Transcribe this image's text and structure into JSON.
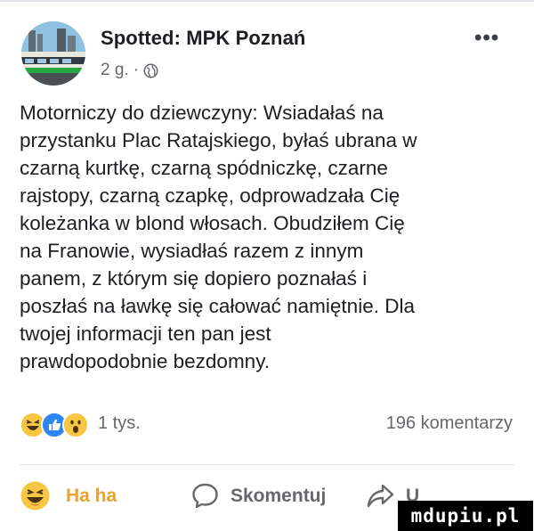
{
  "post": {
    "page_name": "Spotted: MPK Poznań",
    "time": "2 g.",
    "separator": "·",
    "privacy_icon": "globe-icon",
    "more_label": "•••",
    "text": "Motorniczy do dziewczyny: Wsiadałaś na\nprzystanku Plac Ratajskiego, byłaś ubrana w\nczarną kurtkę, czarną spódniczkę, czarne\nrajstopy, czarną czapkę, odprowadzała Cię\nkoleżanka w blond włosach. Obudziłem Cię\nna Franowie, wysiadłaś razem z innym\npanem, z którym się dopiero poznałaś i\nposzłaś na ławkę się całować namiętnie. Dla\ntwojej informacji ten pan jest\nprawdopodobnie bezdomny."
  },
  "stats": {
    "reaction_icons": [
      "haha-icon",
      "like-icon",
      "wow-icon"
    ],
    "reactions": "1 tys.",
    "comments": "196 komentarzy"
  },
  "actions": {
    "haha": "Ha ha",
    "comment": "Skomentuj",
    "share": "U"
  },
  "watermark": "mdupiu.pl",
  "colors": {
    "text": "#1c1e21",
    "secondary": "#65676b",
    "haha": "#e9a22d",
    "like": "#2d87f5"
  }
}
